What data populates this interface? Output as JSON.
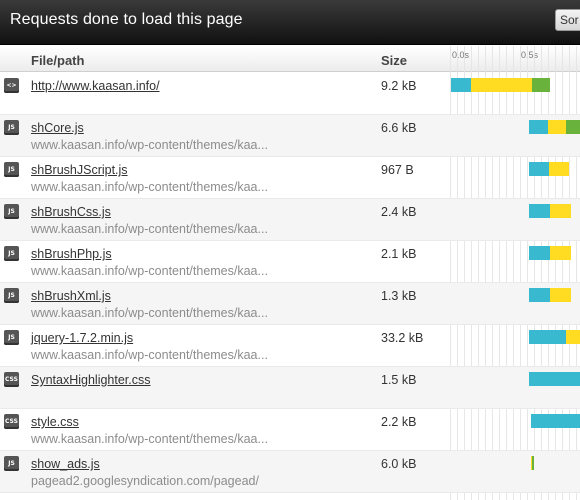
{
  "window": {
    "title": "Requests done to load this page",
    "sort_label": "Sor"
  },
  "columns": {
    "file": "File/path",
    "size": "Size",
    "ticks": [
      "0.0s",
      "0.5s"
    ]
  },
  "colors": {
    "dns": "#39b9cf",
    "wait": "#ffdc21",
    "receive": "#69b33c",
    "icon": "#555555"
  },
  "timeline": {
    "unit_seconds_at_tick": [
      0.0,
      0.5
    ]
  },
  "rows": [
    {
      "icon": "<>",
      "icon_name": "html-file-icon",
      "name": "http://www.kaasan.info/",
      "host": "",
      "size": "9.2 kB",
      "timing": [
        {
          "phase": "dns",
          "start": 0.0,
          "end": 0.14
        },
        {
          "phase": "wait",
          "start": 0.14,
          "end": 0.58
        },
        {
          "phase": "receive",
          "start": 0.58,
          "end": 0.71
        }
      ]
    },
    {
      "icon": "JS",
      "icon_name": "js-file-icon",
      "name": "shCore.js",
      "host": "www.kaasan.info/wp-content/themes/kaa...",
      "size": "6.6 kB",
      "timing": [
        {
          "phase": "dns",
          "start": 0.56,
          "end": 0.69
        },
        {
          "phase": "wait",
          "start": 0.69,
          "end": 0.82
        },
        {
          "phase": "receive",
          "start": 0.82,
          "end": 0.95
        }
      ]
    },
    {
      "icon": "JS",
      "icon_name": "js-file-icon",
      "name": "shBrushJScript.js",
      "host": "www.kaasan.info/wp-content/themes/kaa...",
      "size": "967 B",
      "timing": [
        {
          "phase": "dns",
          "start": 0.56,
          "end": 0.7
        },
        {
          "phase": "wait",
          "start": 0.7,
          "end": 0.84
        }
      ]
    },
    {
      "icon": "JS",
      "icon_name": "js-file-icon",
      "name": "shBrushCss.js",
      "host": "www.kaasan.info/wp-content/themes/kaa...",
      "size": "2.4 kB",
      "timing": [
        {
          "phase": "dns",
          "start": 0.56,
          "end": 0.71
        },
        {
          "phase": "wait",
          "start": 0.71,
          "end": 0.86
        }
      ]
    },
    {
      "icon": "JS",
      "icon_name": "js-file-icon",
      "name": "shBrushPhp.js",
      "host": "www.kaasan.info/wp-content/themes/kaa...",
      "size": "2.1 kB",
      "timing": [
        {
          "phase": "dns",
          "start": 0.56,
          "end": 0.71
        },
        {
          "phase": "wait",
          "start": 0.71,
          "end": 0.86
        }
      ]
    },
    {
      "icon": "JS",
      "icon_name": "js-file-icon",
      "name": "shBrushXml.js",
      "host": "www.kaasan.info/wp-content/themes/kaa...",
      "size": "1.3 kB",
      "timing": [
        {
          "phase": "dns",
          "start": 0.56,
          "end": 0.71
        },
        {
          "phase": "wait",
          "start": 0.71,
          "end": 0.86
        }
      ]
    },
    {
      "icon": "JS",
      "icon_name": "js-file-icon",
      "name": "jquery-1.7.2.min.js",
      "host": "www.kaasan.info/wp-content/themes/kaa...",
      "size": "33.2 kB",
      "timing": [
        {
          "phase": "dns",
          "start": 0.56,
          "end": 0.82
        },
        {
          "phase": "wait",
          "start": 0.82,
          "end": 0.95
        }
      ]
    },
    {
      "icon": "CSS",
      "icon_name": "css-file-icon",
      "name": "SyntaxHighlighter.css",
      "host": "",
      "size": "1.5 kB",
      "timing": [
        {
          "phase": "dns",
          "start": 0.56,
          "end": 0.95
        }
      ]
    },
    {
      "icon": "CSS",
      "icon_name": "css-file-icon",
      "name": "style.css",
      "host": "www.kaasan.info/wp-content/themes/kaa...",
      "size": "2.2 kB",
      "timing": [
        {
          "phase": "dns",
          "start": 0.57,
          "end": 0.95
        }
      ]
    },
    {
      "icon": "JS",
      "icon_name": "js-file-icon",
      "name": "show_ads.js",
      "host": "pagead2.googlesyndication.com/pagead/",
      "size": "6.0 kB",
      "timing": [
        {
          "phase": "wait",
          "start": 0.572,
          "end": 0.58
        },
        {
          "phase": "receive",
          "start": 0.58,
          "end": 0.588
        }
      ]
    }
  ]
}
